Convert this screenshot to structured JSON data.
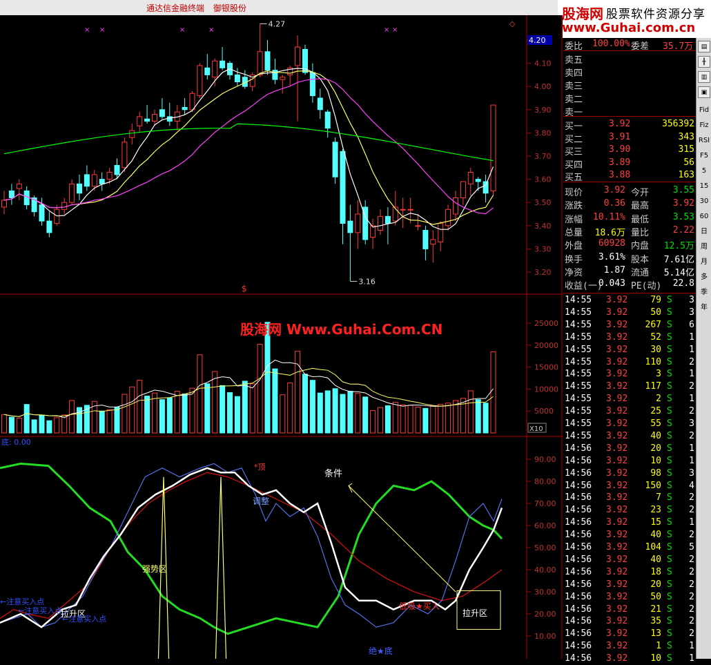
{
  "header": {
    "app_title": "通达信金融终端",
    "stock_name": "御银股份"
  },
  "watermark": {
    "top_line1_brand": "股海网",
    "top_line1_text": "股票软件资源分享",
    "top_line2": "www.Guhai.com.cn",
    "center": "股海网 Www.Guhai.Com.CN"
  },
  "price_panel": {
    "y_ticks": [
      "4.20",
      "4.10",
      "4.00",
      "3.90",
      "3.80",
      "3.70",
      "3.60",
      "3.50",
      "3.40",
      "3.30",
      "3.20"
    ],
    "price_badge": "4.20",
    "high_marker": "4.27",
    "low_marker": "3.16",
    "signal_symbol": "$",
    "top_marks": [
      "×",
      "×",
      "×",
      "×",
      "×",
      "×"
    ],
    "corner_symbol": "◇"
  },
  "volume_panel": {
    "y_ticks": [
      "25000",
      "20000",
      "15000",
      "10000",
      "5000"
    ],
    "unit_badge": "X10"
  },
  "indicator_panel": {
    "name_label": "底: 0.00",
    "y_ticks": [
      "90.00",
      "80.00",
      "70.00",
      "60.00",
      "50.00",
      "40.00",
      "30.00",
      "20.00",
      "10.00"
    ],
    "annotations": {
      "top": "*顶",
      "adjust": "调整",
      "condition": "条件",
      "strong": "强势区",
      "lift_left": "拉升区",
      "lift_right": "拉升区",
      "low_buy": "低吸★买入",
      "bottom": "绝★底",
      "attn1": "←注意买入点",
      "attn2": "←注意买入点",
      "attn3": "←注意买入点"
    }
  },
  "order_book": {
    "ratio_label": "委比",
    "ratio_value": "100.00%",
    "diff_label": "委差",
    "diff_value": "35.7万",
    "asks": [
      "卖五",
      "卖四",
      "卖三",
      "卖二",
      "卖一"
    ],
    "bids": [
      {
        "label": "买一",
        "price": "3.92",
        "vol": "356392"
      },
      {
        "label": "买二",
        "price": "3.91",
        "vol": "343"
      },
      {
        "label": "买三",
        "price": "3.90",
        "vol": "315"
      },
      {
        "label": "买四",
        "price": "3.89",
        "vol": "56"
      },
      {
        "label": "买五",
        "price": "3.88",
        "vol": "163"
      }
    ]
  },
  "stats": [
    {
      "l1": "现价",
      "v1": "3.92",
      "l2": "今开",
      "v2": "3.55",
      "c1": "red",
      "c2": "grn"
    },
    {
      "l1": "涨跌",
      "v1": "0.36",
      "l2": "最高",
      "v2": "3.92",
      "c1": "red",
      "c2": "red"
    },
    {
      "l1": "涨幅",
      "v1": "10.11%",
      "l2": "最低",
      "v2": "3.53",
      "c1": "red",
      "c2": "grn"
    },
    {
      "l1": "总量",
      "v1": "18.6万",
      "l2": "量比",
      "v2": "2.22",
      "c1": "yel",
      "c2": "red"
    },
    {
      "l1": "外盘",
      "v1": "60928",
      "l2": "内盘",
      "v2": "12.5万",
      "c1": "red",
      "c2": "grn"
    },
    {
      "l1": "换手",
      "v1": "3.61%",
      "l2": "股本",
      "v2": "7.61亿",
      "c1": "wht",
      "c2": "wht"
    },
    {
      "l1": "净资",
      "v1": "1.87",
      "l2": "流通",
      "v2": "5.14亿",
      "c1": "wht",
      "c2": "wht"
    },
    {
      "l1": "收益(一)",
      "v1": "0.043",
      "l2": "PE(动)",
      "v2": "22.8",
      "c1": "wht",
      "c2": "wht"
    }
  ],
  "ticks": [
    {
      "t": "14:55",
      "p": "3.92",
      "v": "79",
      "d": "S",
      "n": "3"
    },
    {
      "t": "14:55",
      "p": "3.92",
      "v": "50",
      "d": "S",
      "n": "3"
    },
    {
      "t": "14:55",
      "p": "3.92",
      "v": "267",
      "d": "S",
      "n": "6"
    },
    {
      "t": "14:55",
      "p": "3.92",
      "v": "52",
      "d": "S",
      "n": "1"
    },
    {
      "t": "14:55",
      "p": "3.92",
      "v": "30",
      "d": "S",
      "n": "1"
    },
    {
      "t": "14:55",
      "p": "3.92",
      "v": "110",
      "d": "S",
      "n": "2"
    },
    {
      "t": "14:55",
      "p": "3.92",
      "v": "3",
      "d": "S",
      "n": "1"
    },
    {
      "t": "14:55",
      "p": "3.92",
      "v": "117",
      "d": "S",
      "n": "2"
    },
    {
      "t": "14:55",
      "p": "3.92",
      "v": "2",
      "d": "S",
      "n": "1"
    },
    {
      "t": "14:55",
      "p": "3.92",
      "v": "25",
      "d": "S",
      "n": "2"
    },
    {
      "t": "14:55",
      "p": "3.92",
      "v": "55",
      "d": "S",
      "n": "3"
    },
    {
      "t": "14:55",
      "p": "3.92",
      "v": "40",
      "d": "S",
      "n": "2"
    },
    {
      "t": "14:56",
      "p": "3.92",
      "v": "20",
      "d": "S",
      "n": "1"
    },
    {
      "t": "14:56",
      "p": "3.92",
      "v": "10",
      "d": "S",
      "n": "1"
    },
    {
      "t": "14:56",
      "p": "3.92",
      "v": "98",
      "d": "S",
      "n": "3"
    },
    {
      "t": "14:56",
      "p": "3.92",
      "v": "150",
      "d": "S",
      "n": "4"
    },
    {
      "t": "14:56",
      "p": "3.92",
      "v": "7",
      "d": "S",
      "n": "2"
    },
    {
      "t": "14:56",
      "p": "3.92",
      "v": "23",
      "d": "S",
      "n": "2"
    },
    {
      "t": "14:56",
      "p": "3.92",
      "v": "15",
      "d": "S",
      "n": "1"
    },
    {
      "t": "14:56",
      "p": "3.92",
      "v": "40",
      "d": "S",
      "n": "2"
    },
    {
      "t": "14:56",
      "p": "3.92",
      "v": "104",
      "d": "S",
      "n": "5"
    },
    {
      "t": "14:56",
      "p": "3.92",
      "v": "40",
      "d": "S",
      "n": "2"
    },
    {
      "t": "14:56",
      "p": "3.92",
      "v": "18",
      "d": "S",
      "n": "2"
    },
    {
      "t": "14:56",
      "p": "3.92",
      "v": "20",
      "d": "S",
      "n": "2"
    },
    {
      "t": "14:56",
      "p": "3.92",
      "v": "50",
      "d": "S",
      "n": "2"
    },
    {
      "t": "14:56",
      "p": "3.92",
      "v": "21",
      "d": "S",
      "n": "2"
    },
    {
      "t": "14:56",
      "p": "3.92",
      "v": "35",
      "d": "S",
      "n": "2"
    },
    {
      "t": "14:56",
      "p": "3.92",
      "v": "13",
      "d": "S",
      "n": "2"
    },
    {
      "t": "14:56",
      "p": "3.92",
      "v": "1",
      "d": "S",
      "n": "1"
    },
    {
      "t": "14:56",
      "p": "3.92",
      "v": "10",
      "d": "S",
      "n": "1"
    }
  ],
  "toolbar": {
    "top_icons": [
      "chart-icon",
      "candle-icon",
      "bar-icon",
      "lock-icon"
    ],
    "text_buttons": [
      "Fid",
      "Fiz",
      "RSI",
      "F5",
      "5",
      "15",
      "30",
      "60",
      "日",
      "周",
      "月",
      "多",
      "季",
      "年"
    ]
  },
  "colors": {
    "up": "#ff3b3b",
    "down": "#54ffff",
    "ma5": "#ffffff",
    "ma10": "#ffff66",
    "ma20": "#ff40ff",
    "ma60": "#00ff00",
    "grid": "#a00000"
  }
}
